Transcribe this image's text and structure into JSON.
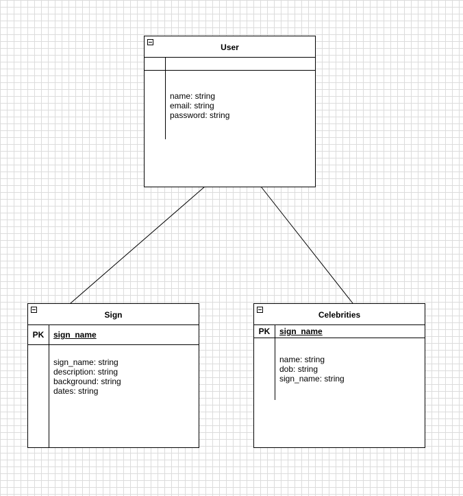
{
  "tables": {
    "user": {
      "title": "User",
      "fields": [
        "name: string",
        "email: string",
        "password: string"
      ]
    },
    "sign": {
      "title": "Sign",
      "key_label": "PK",
      "key_name": "sign_name",
      "fields": [
        "sign_name: string",
        "description: string",
        "background: string",
        "dates: string"
      ]
    },
    "celebrities": {
      "title": "Celebrities",
      "key_label": "PK",
      "key_name": "sign_name",
      "fields": [
        "name: string",
        "dob: string",
        "sign_name: string"
      ]
    }
  },
  "relationships": [
    {
      "from": "User",
      "to": "Sign"
    },
    {
      "from": "User",
      "to": "Celebrities"
    }
  ]
}
